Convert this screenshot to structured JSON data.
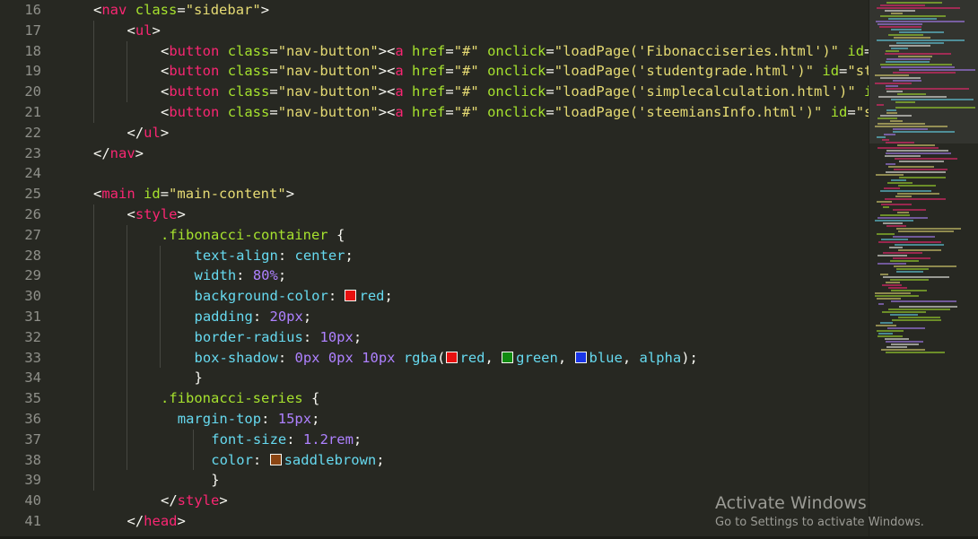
{
  "editor": {
    "lines": [
      {
        "num": "16",
        "parts": [
          {
            "t": "<",
            "c": "c-txt"
          },
          {
            "t": "nav",
            "c": "c-tag"
          },
          {
            "t": " ",
            "c": "c-txt"
          },
          {
            "t": "class",
            "c": "c-attr"
          },
          {
            "t": "=",
            "c": "c-txt"
          },
          {
            "t": "\"sidebar\"",
            "c": "c-str"
          },
          {
            "t": ">",
            "c": "c-txt"
          }
        ]
      },
      {
        "num": "17",
        "parts": [
          {
            "t": "<",
            "c": "c-txt"
          },
          {
            "t": "ul",
            "c": "c-tag"
          },
          {
            "t": ">",
            "c": "c-txt"
          }
        ]
      },
      {
        "num": "18",
        "parts": [
          {
            "t": "<",
            "c": "c-txt"
          },
          {
            "t": "button",
            "c": "c-tag"
          },
          {
            "t": " ",
            "c": "c-txt"
          },
          {
            "t": "class",
            "c": "c-attr"
          },
          {
            "t": "=",
            "c": "c-txt"
          },
          {
            "t": "\"nav-button\"",
            "c": "c-str"
          },
          {
            "t": "><",
            "c": "c-txt"
          },
          {
            "t": "a",
            "c": "c-tag"
          },
          {
            "t": " ",
            "c": "c-txt"
          },
          {
            "t": "href",
            "c": "c-attr"
          },
          {
            "t": "=",
            "c": "c-txt"
          },
          {
            "t": "\"#\"",
            "c": "c-str"
          },
          {
            "t": " ",
            "c": "c-txt"
          },
          {
            "t": "onclick",
            "c": "c-attr"
          },
          {
            "t": "=",
            "c": "c-txt"
          },
          {
            "t": "\"loadPage('Fibonacciseries.html')\"",
            "c": "c-str"
          },
          {
            "t": " ",
            "c": "c-txt"
          },
          {
            "t": "id",
            "c": "c-attr"
          },
          {
            "t": "=",
            "c": "c-txt"
          },
          {
            "t": "\"",
            "c": "c-str"
          }
        ]
      },
      {
        "num": "19",
        "parts": [
          {
            "t": "<",
            "c": "c-txt"
          },
          {
            "t": "button",
            "c": "c-tag"
          },
          {
            "t": " ",
            "c": "c-txt"
          },
          {
            "t": "class",
            "c": "c-attr"
          },
          {
            "t": "=",
            "c": "c-txt"
          },
          {
            "t": "\"nav-button\"",
            "c": "c-str"
          },
          {
            "t": "><",
            "c": "c-txt"
          },
          {
            "t": "a",
            "c": "c-tag"
          },
          {
            "t": " ",
            "c": "c-txt"
          },
          {
            "t": "href",
            "c": "c-attr"
          },
          {
            "t": "=",
            "c": "c-txt"
          },
          {
            "t": "\"#\"",
            "c": "c-str"
          },
          {
            "t": " ",
            "c": "c-txt"
          },
          {
            "t": "onclick",
            "c": "c-attr"
          },
          {
            "t": "=",
            "c": "c-txt"
          },
          {
            "t": "\"loadPage('studentgrade.html')\"",
            "c": "c-str"
          },
          {
            "t": " ",
            "c": "c-txt"
          },
          {
            "t": "id",
            "c": "c-attr"
          },
          {
            "t": "=",
            "c": "c-txt"
          },
          {
            "t": "\"stu",
            "c": "c-str"
          }
        ]
      },
      {
        "num": "20",
        "parts": [
          {
            "t": "<",
            "c": "c-txt"
          },
          {
            "t": "button",
            "c": "c-tag"
          },
          {
            "t": " ",
            "c": "c-txt"
          },
          {
            "t": "class",
            "c": "c-attr"
          },
          {
            "t": "=",
            "c": "c-txt"
          },
          {
            "t": "\"nav-button\"",
            "c": "c-str"
          },
          {
            "t": "><",
            "c": "c-txt"
          },
          {
            "t": "a",
            "c": "c-tag"
          },
          {
            "t": " ",
            "c": "c-txt"
          },
          {
            "t": "href",
            "c": "c-attr"
          },
          {
            "t": "=",
            "c": "c-txt"
          },
          {
            "t": "\"#\"",
            "c": "c-str"
          },
          {
            "t": " ",
            "c": "c-txt"
          },
          {
            "t": "onclick",
            "c": "c-attr"
          },
          {
            "t": "=",
            "c": "c-txt"
          },
          {
            "t": "\"loadPage('simplecalculation.html')\"",
            "c": "c-str"
          },
          {
            "t": " ",
            "c": "c-txt"
          },
          {
            "t": "id",
            "c": "c-attr"
          }
        ]
      },
      {
        "num": "21",
        "parts": [
          {
            "t": "<",
            "c": "c-txt"
          },
          {
            "t": "button",
            "c": "c-tag"
          },
          {
            "t": " ",
            "c": "c-txt"
          },
          {
            "t": "class",
            "c": "c-attr"
          },
          {
            "t": "=",
            "c": "c-txt"
          },
          {
            "t": "\"nav-button\"",
            "c": "c-str"
          },
          {
            "t": "><",
            "c": "c-txt"
          },
          {
            "t": "a",
            "c": "c-tag"
          },
          {
            "t": " ",
            "c": "c-txt"
          },
          {
            "t": "href",
            "c": "c-attr"
          },
          {
            "t": "=",
            "c": "c-txt"
          },
          {
            "t": "\"#\"",
            "c": "c-str"
          },
          {
            "t": " ",
            "c": "c-txt"
          },
          {
            "t": "onclick",
            "c": "c-attr"
          },
          {
            "t": "=",
            "c": "c-txt"
          },
          {
            "t": "\"loadPage('steemiansInfo.html')\"",
            "c": "c-str"
          },
          {
            "t": " ",
            "c": "c-txt"
          },
          {
            "t": "id",
            "c": "c-attr"
          },
          {
            "t": "=",
            "c": "c-txt"
          },
          {
            "t": "\"st",
            "c": "c-str"
          }
        ]
      },
      {
        "num": "22",
        "parts": [
          {
            "t": "</",
            "c": "c-txt"
          },
          {
            "t": "ul",
            "c": "c-tag"
          },
          {
            "t": ">",
            "c": "c-txt"
          }
        ]
      },
      {
        "num": "23",
        "parts": [
          {
            "t": "</",
            "c": "c-txt"
          },
          {
            "t": "nav",
            "c": "c-tag"
          },
          {
            "t": ">",
            "c": "c-txt"
          }
        ]
      },
      {
        "num": "24",
        "parts": []
      },
      {
        "num": "25",
        "parts": [
          {
            "t": "<",
            "c": "c-txt"
          },
          {
            "t": "main",
            "c": "c-tag"
          },
          {
            "t": " ",
            "c": "c-txt"
          },
          {
            "t": "id",
            "c": "c-attr"
          },
          {
            "t": "=",
            "c": "c-txt"
          },
          {
            "t": "\"main-content\"",
            "c": "c-str"
          },
          {
            "t": ">",
            "c": "c-txt"
          }
        ]
      },
      {
        "num": "26",
        "parts": [
          {
            "t": "<",
            "c": "c-txt"
          },
          {
            "t": "style",
            "c": "c-tag"
          },
          {
            "t": ">",
            "c": "c-txt"
          }
        ]
      },
      {
        "num": "27",
        "parts": [
          {
            "t": ".fibonacci-container",
            "c": "c-sel"
          },
          {
            "t": " {",
            "c": "c-txt"
          }
        ]
      },
      {
        "num": "28",
        "parts": [
          {
            "t": "text-align",
            "c": "c-prop"
          },
          {
            "t": ": ",
            "c": "c-txt"
          },
          {
            "t": "center",
            "c": "c-col"
          },
          {
            "t": ";",
            "c": "c-txt"
          }
        ]
      },
      {
        "num": "29",
        "parts": [
          {
            "t": "width",
            "c": "c-prop"
          },
          {
            "t": ": ",
            "c": "c-txt"
          },
          {
            "t": "80%",
            "c": "c-num"
          },
          {
            "t": ";",
            "c": "c-txt"
          }
        ]
      },
      {
        "num": "30",
        "parts": [
          {
            "t": "background-color",
            "c": "c-prop"
          },
          {
            "t": ": ",
            "c": "c-txt"
          },
          {
            "sw": "#e81010"
          },
          {
            "t": "red",
            "c": "c-col"
          },
          {
            "t": ";",
            "c": "c-txt"
          }
        ]
      },
      {
        "num": "31",
        "parts": [
          {
            "t": "padding",
            "c": "c-prop"
          },
          {
            "t": ": ",
            "c": "c-txt"
          },
          {
            "t": "20px",
            "c": "c-num"
          },
          {
            "t": ";",
            "c": "c-txt"
          }
        ]
      },
      {
        "num": "32",
        "parts": [
          {
            "t": "border-radius",
            "c": "c-prop"
          },
          {
            "t": ": ",
            "c": "c-txt"
          },
          {
            "t": "10px",
            "c": "c-num"
          },
          {
            "t": ";",
            "c": "c-txt"
          }
        ]
      },
      {
        "num": "33",
        "parts": [
          {
            "t": "box-shadow",
            "c": "c-prop"
          },
          {
            "t": ": ",
            "c": "c-txt"
          },
          {
            "t": "0px 0px 10px",
            "c": "c-num"
          },
          {
            "t": " ",
            "c": "c-txt"
          },
          {
            "t": "rgba",
            "c": "c-fn"
          },
          {
            "t": "(",
            "c": "c-txt"
          },
          {
            "sw": "#e81010"
          },
          {
            "t": "red",
            "c": "c-col"
          },
          {
            "t": ", ",
            "c": "c-txt"
          },
          {
            "sw": "#108a10"
          },
          {
            "t": "green",
            "c": "c-col"
          },
          {
            "t": ", ",
            "c": "c-txt"
          },
          {
            "sw": "#1a35e8"
          },
          {
            "t": "blue",
            "c": "c-col"
          },
          {
            "t": ", ",
            "c": "c-txt"
          },
          {
            "t": "alpha",
            "c": "c-col"
          },
          {
            "t": ");",
            "c": "c-txt"
          }
        ]
      },
      {
        "num": "34",
        "parts": [
          {
            "t": "}",
            "c": "c-txt"
          }
        ]
      },
      {
        "num": "35",
        "parts": [
          {
            "t": ".fibonacci-series",
            "c": "c-sel"
          },
          {
            "t": " {",
            "c": "c-txt"
          }
        ]
      },
      {
        "num": "36",
        "parts": [
          {
            "t": "margin-top",
            "c": "c-prop"
          },
          {
            "t": ": ",
            "c": "c-txt"
          },
          {
            "t": "15px",
            "c": "c-num"
          },
          {
            "t": ";",
            "c": "c-txt"
          }
        ]
      },
      {
        "num": "37",
        "parts": [
          {
            "t": "font-size",
            "c": "c-prop"
          },
          {
            "t": ": ",
            "c": "c-txt"
          },
          {
            "t": "1.2rem",
            "c": "c-num"
          },
          {
            "t": ";",
            "c": "c-txt"
          }
        ]
      },
      {
        "num": "38",
        "parts": [
          {
            "t": "color",
            "c": "c-prop"
          },
          {
            "t": ": ",
            "c": "c-txt"
          },
          {
            "sw": "#8b4513"
          },
          {
            "t": "saddlebrown",
            "c": "c-col"
          },
          {
            "t": ";",
            "c": "c-txt"
          }
        ]
      },
      {
        "num": "39",
        "parts": [
          {
            "t": "}",
            "c": "c-txt"
          }
        ]
      },
      {
        "num": "40",
        "parts": [
          {
            "t": "</",
            "c": "c-txt"
          },
          {
            "t": "style",
            "c": "c-tag"
          },
          {
            "t": ">",
            "c": "c-txt"
          }
        ]
      },
      {
        "num": "41",
        "parts": [
          {
            "t": "</",
            "c": "c-txt"
          },
          {
            "t": "head",
            "c": "c-tag"
          },
          {
            "t": ">",
            "c": "c-txt"
          }
        ]
      }
    ]
  },
  "watermark": {
    "title": "Activate Windows",
    "subtitle": "Go to Settings to activate Windows."
  }
}
